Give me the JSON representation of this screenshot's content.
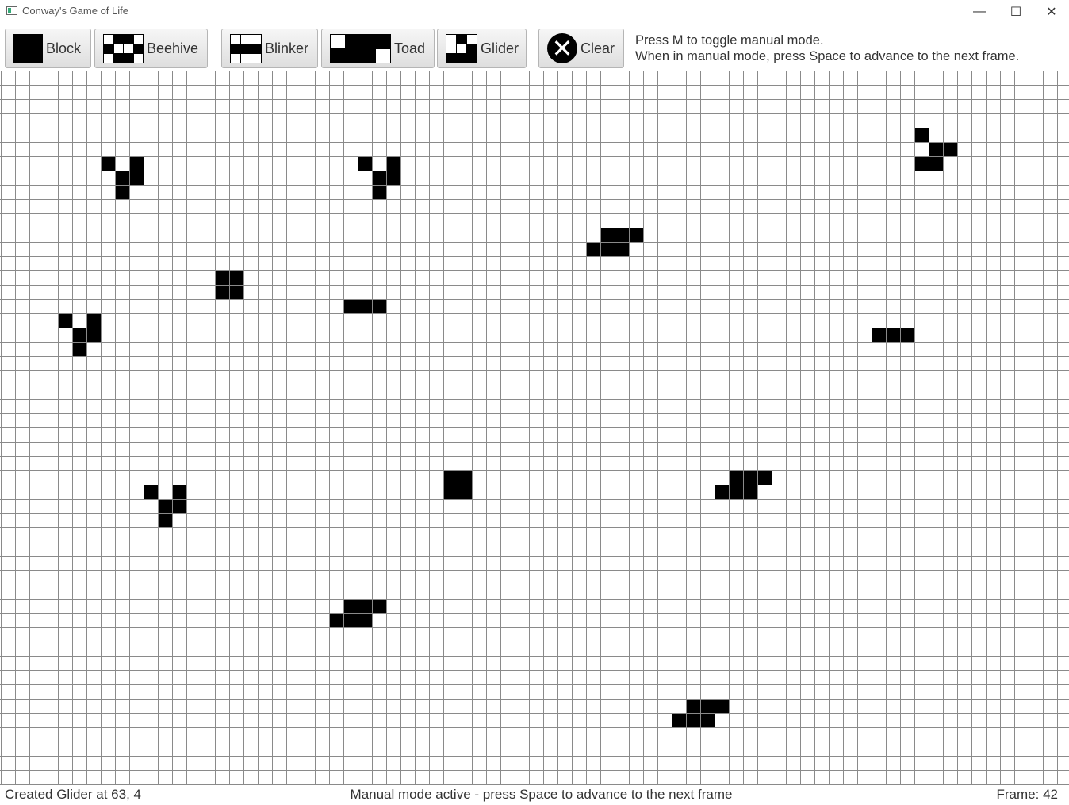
{
  "window": {
    "title": "Conway's Game of Life",
    "minimize_glyph": "—",
    "maximize_glyph": "☐",
    "close_glyph": "✕"
  },
  "toolbar": {
    "buttons": [
      {
        "label": "Block",
        "icon": "block-pattern-icon"
      },
      {
        "label": "Beehive",
        "icon": "beehive-pattern-icon"
      },
      {
        "label": "Blinker",
        "icon": "blinker-pattern-icon"
      },
      {
        "label": "Toad",
        "icon": "toad-pattern-icon"
      },
      {
        "label": "Glider",
        "icon": "glider-pattern-icon"
      },
      {
        "label": "Clear",
        "icon": "clear-icon",
        "glyph": "✕"
      }
    ],
    "help_line1": "Press M to toggle manual mode.",
    "help_line2": "When in manual mode, press Space to advance to the next frame."
  },
  "board": {
    "columns": 75,
    "rows": 50,
    "live_cell_color": "#000000",
    "grid_line_color": "#8a8a8a",
    "live_cells": [
      [
        64,
        4
      ],
      [
        65,
        5
      ],
      [
        66,
        5
      ],
      [
        64,
        6
      ],
      [
        65,
        6
      ],
      [
        7,
        6
      ],
      [
        9,
        6
      ],
      [
        8,
        7
      ],
      [
        9,
        7
      ],
      [
        8,
        8
      ],
      [
        25,
        6
      ],
      [
        27,
        6
      ],
      [
        26,
        7
      ],
      [
        27,
        7
      ],
      [
        26,
        8
      ],
      [
        42,
        11
      ],
      [
        43,
        11
      ],
      [
        44,
        11
      ],
      [
        41,
        12
      ],
      [
        42,
        12
      ],
      [
        43,
        12
      ],
      [
        15,
        14
      ],
      [
        16,
        14
      ],
      [
        15,
        15
      ],
      [
        16,
        15
      ],
      [
        24,
        16
      ],
      [
        25,
        16
      ],
      [
        26,
        16
      ],
      [
        4,
        17
      ],
      [
        6,
        17
      ],
      [
        5,
        18
      ],
      [
        6,
        18
      ],
      [
        5,
        19
      ],
      [
        61,
        18
      ],
      [
        62,
        18
      ],
      [
        63,
        18
      ],
      [
        51,
        28
      ],
      [
        52,
        28
      ],
      [
        53,
        28
      ],
      [
        50,
        29
      ],
      [
        51,
        29
      ],
      [
        52,
        29
      ],
      [
        31,
        28
      ],
      [
        32,
        28
      ],
      [
        31,
        29
      ],
      [
        32,
        29
      ],
      [
        10,
        29
      ],
      [
        12,
        29
      ],
      [
        11,
        30
      ],
      [
        12,
        30
      ],
      [
        11,
        31
      ],
      [
        24,
        37
      ],
      [
        25,
        37
      ],
      [
        26,
        37
      ],
      [
        23,
        38
      ],
      [
        24,
        38
      ],
      [
        25,
        38
      ],
      [
        48,
        44
      ],
      [
        49,
        44
      ],
      [
        50,
        44
      ],
      [
        47,
        45
      ],
      [
        48,
        45
      ],
      [
        49,
        45
      ]
    ]
  },
  "status": {
    "left": "Created Glider at 63, 4",
    "center": "Manual mode active - press Space to advance to the next frame",
    "right": "Frame: 42"
  }
}
